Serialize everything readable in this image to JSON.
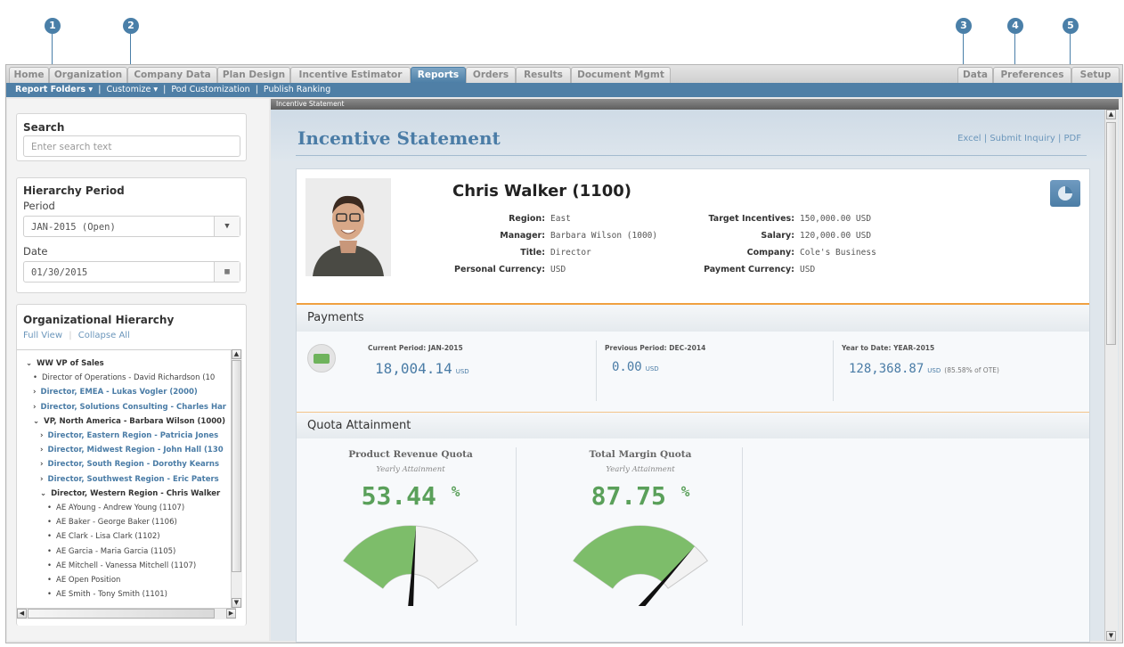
{
  "callouts": [
    "1",
    "2",
    "3",
    "4",
    "5"
  ],
  "tabs": {
    "left": [
      "Home",
      "Organization",
      "Company Data",
      "Plan Design",
      "Incentive Estimator",
      "Reports",
      "Orders",
      "Results",
      "Document Mgmt"
    ],
    "right": [
      "Data",
      "Preferences",
      "Setup"
    ],
    "active": "Reports"
  },
  "subnav": {
    "report_folders": "Report Folders ▾",
    "sep": "|",
    "customize": "Customize ▾",
    "pod_customization": "Pod Customization",
    "publish_ranking": "Publish Ranking"
  },
  "search": {
    "title": "Search",
    "placeholder": "Enter search text"
  },
  "hierarchy_period": {
    "title": "Hierarchy Period",
    "period_label": "Period",
    "period_value": "JAN-2015 (Open)",
    "date_label": "Date",
    "date_value": "01/30/2015"
  },
  "org_hierarchy": {
    "title": "Organizational Hierarchy",
    "full_view": "Full View",
    "collapse_all": "Collapse All",
    "rows": [
      {
        "text": "WW VP of Sales",
        "marker": "⌄"
      },
      {
        "text": "Director of Operations - David Richardson (10",
        "marker": "•"
      },
      {
        "text": "Director, EMEA - Lukas Vogler (2000)",
        "marker": "›"
      },
      {
        "text": "Director, Solutions Consulting - Charles Har",
        "marker": "›"
      },
      {
        "text": "VP, North America - Barbara Wilson (1000)",
        "marker": "⌄"
      },
      {
        "text": "Director, Eastern Region - Patricia Jones",
        "marker": "›"
      },
      {
        "text": "Director, Midwest Region - John Hall (130",
        "marker": "›"
      },
      {
        "text": "Director, South Region - Dorothy Kearns",
        "marker": "›"
      },
      {
        "text": "Director, Southwest Region - Eric Paters",
        "marker": "›"
      },
      {
        "text": "Director, Western Region - Chris Walker",
        "marker": "⌄"
      },
      {
        "text": "AE AYoung - Andrew Young (1107)",
        "marker": "•"
      },
      {
        "text": "AE Baker - George Baker (1106)",
        "marker": "•"
      },
      {
        "text": "AE Clark - Lisa Clark (1102)",
        "marker": "•"
      },
      {
        "text": "AE Garcia - Maria Garcia (1105)",
        "marker": "•"
      },
      {
        "text": "AE Mitchell - Vanessa Mitchell (1107)",
        "marker": "•"
      },
      {
        "text": "AE Open Position",
        "marker": "•"
      },
      {
        "text": "AE Smith - Tony Smith (1101)",
        "marker": "•"
      }
    ]
  },
  "report": {
    "window_title": "Incentive Statement",
    "title": "Incentive Statement",
    "links": {
      "excel": "Excel",
      "submit_inquiry": "Submit Inquiry",
      "pdf": "PDF",
      "sep": "|"
    }
  },
  "profile": {
    "name": "Chris Walker (1100)",
    "left": [
      {
        "k": "Region:",
        "v": "East"
      },
      {
        "k": "Manager:",
        "v": "Barbara Wilson (1000)"
      },
      {
        "k": "Title:",
        "v": "Director"
      },
      {
        "k": "Personal Currency:",
        "v": "USD"
      }
    ],
    "right": [
      {
        "k": "Target Incentives:",
        "v": "150,000.00 USD"
      },
      {
        "k": "Salary:",
        "v": "120,000.00 USD"
      },
      {
        "k": "Company:",
        "v": "Cole's Business"
      },
      {
        "k": "Payment Currency:",
        "v": "USD"
      }
    ]
  },
  "payments": {
    "title": "Payments",
    "items": [
      {
        "label": "Current Period: JAN-2015",
        "value": "18,004.14",
        "unit": "USD",
        "note": ""
      },
      {
        "label": "Previous Period: DEC-2014",
        "value": "0.00",
        "unit": "USD",
        "note": ""
      },
      {
        "label": "Year to Date: YEAR-2015",
        "value": "128,368.87",
        "unit": "USD",
        "note": "(85.58% of OTE)"
      }
    ]
  },
  "quota": {
    "title": "Quota Attainment",
    "gauges": [
      {
        "title": "Product Revenue Quota",
        "sub": "Yearly Attainment",
        "value": "53.44",
        "pct": "%",
        "level": 0.5344
      },
      {
        "title": "Total Margin Quota",
        "sub": "Yearly Attainment",
        "value": "87.75",
        "pct": "%",
        "level": 0.8775
      }
    ]
  },
  "colors": {
    "accent": "#4a7ca6",
    "tab_active": "#4c7ea6",
    "gauge_fill": "#7dbd6a",
    "orange": "#f0a040",
    "value_green": "#5aa05a"
  }
}
